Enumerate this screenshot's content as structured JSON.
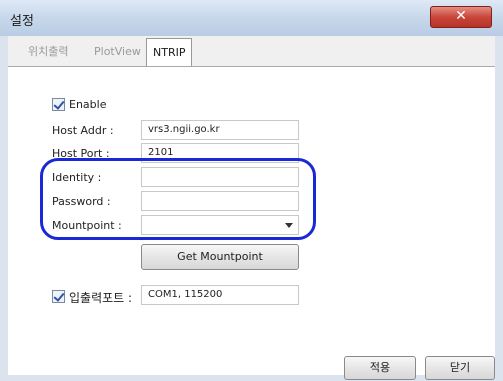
{
  "window": {
    "title": "설정",
    "close_symbol": "✕"
  },
  "tabs": [
    {
      "label": "위치출력"
    },
    {
      "label": "PlotView"
    },
    {
      "label": "NTRIP"
    }
  ],
  "form": {
    "enable_label": "Enable",
    "enable_checked": true,
    "host_addr_label": "Host Addr :",
    "host_addr_value": "vrs3.ngii.go.kr",
    "host_port_label": "Host Port :",
    "host_port_value": "2101",
    "identity_label": "Identity :",
    "identity_value": "",
    "password_label": "Password :",
    "password_value": "",
    "mountpoint_label": "Mountpoint :",
    "mountpoint_value": "",
    "get_mountpoint_label": "Get Mountpoint",
    "io_port_label": "입출력포트 :",
    "io_port_checked": true,
    "io_port_value": "COM1, 115200"
  },
  "footer": {
    "apply_label": "적용",
    "close_label": "닫기"
  },
  "colors": {
    "highlight": "#1a28d6"
  }
}
